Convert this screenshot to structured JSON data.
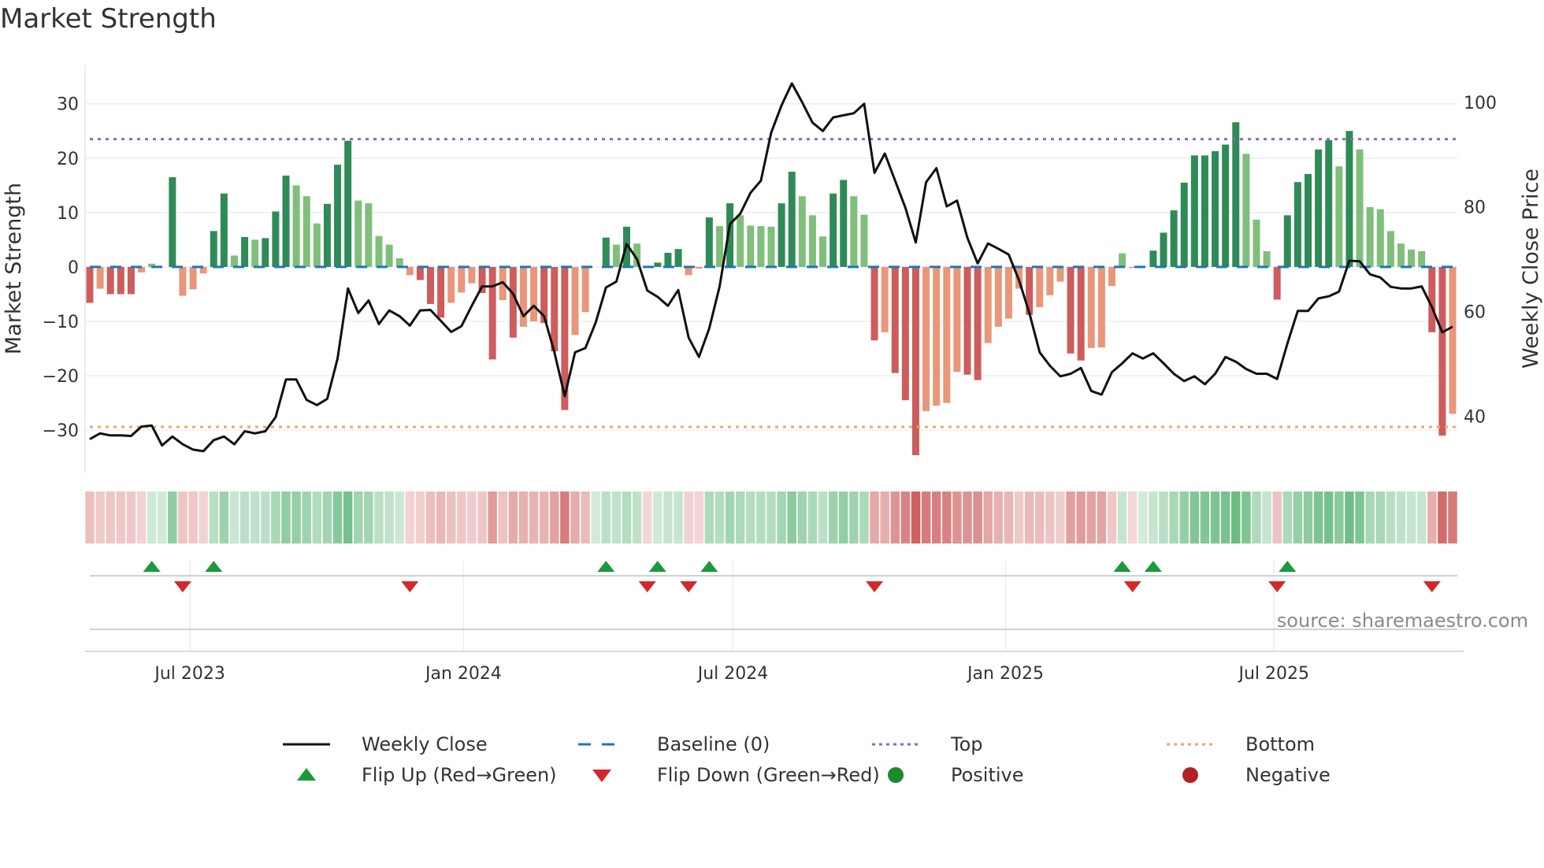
{
  "title": "Market Strength",
  "source": "source: sharemaestro.com",
  "colors": {
    "strong_up": "#2e8b57",
    "weak_up": "#7fbf7b",
    "strong_down": "#cd5c5c",
    "weak_down": "#e9967a",
    "close": "#111111",
    "baseline": "#1f77b4",
    "top": "#9467bd",
    "bottom": "#f4a460",
    "flip_up": "#1a9a3c",
    "flip_down": "#d62728",
    "positive": "#1a8a2a",
    "negative": "#b22222"
  },
  "legend": [
    {
      "label": "Weekly Close",
      "symbol": "line"
    },
    {
      "label": "Baseline (0)",
      "symbol": "dash"
    },
    {
      "label": "Top",
      "symbol": "dot-purple"
    },
    {
      "label": "Bottom",
      "symbol": "dot-orange"
    },
    {
      "label": "Flip Up (Red→Green)",
      "symbol": "triangle-up"
    },
    {
      "label": "Flip Down (Green→Red)",
      "symbol": "triangle-down"
    },
    {
      "label": "Positive",
      "symbol": "circle-green"
    },
    {
      "label": "Negative",
      "symbol": "circle-red"
    }
  ],
  "chart_data": {
    "type": "bar",
    "title": "Market Strength",
    "ylabel": "Market Strength",
    "y2label": "Weekly Close Price",
    "ylim": [
      -37.8,
      37.2
    ],
    "y2lim": [
      29.2,
      107.2
    ],
    "yticks": [
      -30,
      -20,
      -10,
      0,
      10,
      20,
      30
    ],
    "yticklabels": [
      "−30",
      "−20",
      "−10",
      "0",
      "10",
      "20",
      "30"
    ],
    "y2ticks": [
      40,
      60,
      80,
      100
    ],
    "y2ticklabels": [
      "40",
      "60",
      "80",
      "100"
    ],
    "top_level": 23.5,
    "bottom_level": -29.4,
    "xticks": [
      {
        "week": 9.7,
        "label": "Jul 2023"
      },
      {
        "week": 36.2,
        "label": "Jan 2024"
      },
      {
        "week": 62.3,
        "label": "Jul 2024"
      },
      {
        "week": 88.7,
        "label": "Jan 2025"
      },
      {
        "week": 114.7,
        "label": "Jul 2025"
      }
    ],
    "strength": [
      -6.6,
      -4,
      -5,
      -5,
      -5,
      -1,
      0.6,
      0,
      16.5,
      -5.3,
      -4.1,
      -1.2,
      6.6,
      13.5,
      2.1,
      5.5,
      5,
      5.3,
      10.2,
      16.8,
      15,
      13,
      8,
      11.6,
      18.8,
      23.2,
      12.2,
      11.7,
      5.7,
      4.1,
      1.6,
      -1.5,
      -2.4,
      -6.8,
      -9.3,
      -6.6,
      -4.7,
      -3,
      -4.8,
      -17,
      -6.1,
      -13,
      -11,
      -10,
      -10.3,
      -15.5,
      -26.3,
      -12.5,
      -8.3,
      0,
      5.4,
      4.1,
      7.4,
      4.3,
      -0.2,
      0.8,
      2.6,
      3.3,
      -1.5,
      -0.3,
      9.1,
      7.5,
      11.7,
      9.5,
      7.6,
      7.5,
      7.4,
      11.7,
      17.5,
      13,
      9.5,
      5.6,
      13.5,
      16,
      13,
      9.6,
      -13.5,
      -12,
      -19.5,
      -24.5,
      -34.6,
      -26.5,
      -25.5,
      -25,
      -19.3,
      -19.8,
      -20.8,
      -14,
      -11,
      -9.5,
      -4,
      -8.8,
      -7.4,
      -5.2,
      -2.7,
      -15.9,
      -17.2,
      -14.9,
      -14.8,
      -3.5,
      2.5,
      -0.2,
      0,
      3,
      6.3,
      10.4,
      15.5,
      20.5,
      20.5,
      21.3,
      22.5,
      26.6,
      20.8,
      8.7,
      2.9,
      -6,
      9.5,
      15.6,
      17.1,
      21.6,
      23.3,
      18.5,
      25,
      21.6,
      11,
      10.6,
      6.6,
      4.3,
      3.2,
      2.9,
      -12,
      -31,
      -27
    ],
    "weekly_close": [
      35.6,
      36.7,
      36.3,
      36.3,
      36.2,
      38.0,
      38.2,
      34.4,
      36.1,
      34.6,
      33.6,
      33.3,
      35.4,
      36.1,
      34.6,
      37.1,
      36.7,
      37.1,
      39.8,
      47.0,
      47.0,
      43.1,
      42.1,
      43.3,
      51.0,
      64.4,
      59.7,
      62.1,
      57.6,
      60.2,
      59.1,
      57.3,
      60.2,
      60.3,
      58.2,
      56.1,
      57.2,
      61.1,
      64.8,
      64.8,
      65.6,
      63.4,
      59.1,
      61.1,
      59.1,
      52.2,
      43.8,
      52.2,
      53.0,
      57.9,
      64.6,
      65.7,
      72.9,
      70.0,
      64.0,
      62.8,
      61.1,
      64.1,
      55.0,
      51.3,
      56.8,
      64.8,
      76.7,
      78.7,
      82.7,
      85.0,
      94.2,
      99.4,
      103.6,
      100.0,
      96.1,
      94.5,
      97.1,
      97.5,
      97.9,
      99.7,
      86.5,
      90.2,
      85.0,
      79.8,
      73.2,
      84.7,
      87.4,
      80.1,
      81.2,
      74.1,
      69.2,
      73.0,
      72.0,
      70.9,
      66.0,
      59.7,
      52.2,
      49.6,
      47.6,
      48.1,
      49.2,
      44.8,
      44.1,
      48.4,
      50.1,
      52.0,
      51.0,
      52.0,
      50.1,
      48.1,
      46.7,
      47.6,
      46.1,
      48.1,
      51.3,
      50.4,
      49.0,
      48.1,
      48.1,
      47.1,
      53.9,
      60.1,
      60.1,
      62.5,
      62.9,
      63.8,
      69.7,
      69.6,
      67.1,
      66.5,
      64.7,
      64.4,
      64.4,
      64.8,
      60.8,
      56.0,
      57.1
    ],
    "flip_up_weeks": [
      6,
      12,
      50,
      55,
      60,
      100,
      103,
      116
    ],
    "flip_down_weeks": [
      9,
      31,
      54,
      58,
      76,
      101,
      115,
      130
    ]
  }
}
